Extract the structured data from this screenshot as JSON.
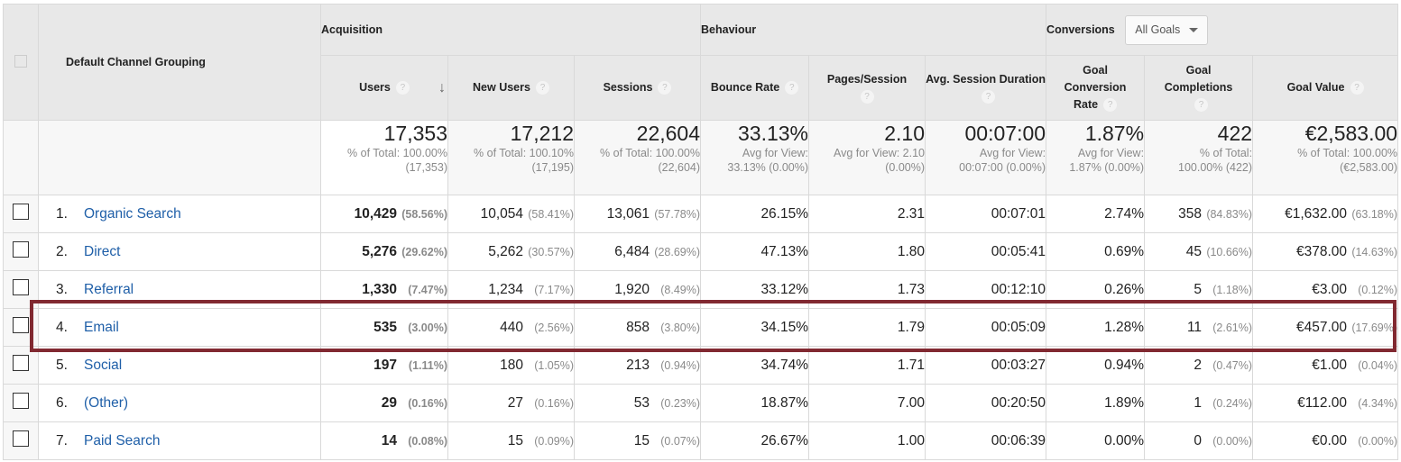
{
  "header": {
    "dimension_label": "Default Channel Grouping",
    "groups": {
      "acquisition": "Acquisition",
      "behaviour": "Behaviour",
      "conversions": "Conversions"
    },
    "goal_select": {
      "selected": "All Goals"
    },
    "columns": [
      {
        "key": "users",
        "label": "Users",
        "sorted": "descending"
      },
      {
        "key": "new_users",
        "label": "New Users"
      },
      {
        "key": "sessions",
        "label": "Sessions"
      },
      {
        "key": "bounce_rate",
        "label": "Bounce Rate"
      },
      {
        "key": "pages_session",
        "label": "Pages/Session"
      },
      {
        "key": "avg_session_duration",
        "label": "Avg. Session Duration"
      },
      {
        "key": "goal_conversion_rate",
        "label": "Goal Conversion Rate"
      },
      {
        "key": "goal_completions",
        "label": "Goal Completions"
      },
      {
        "key": "goal_value",
        "label": "Goal Value"
      }
    ],
    "help_icon": "?",
    "sort_icon": "↓"
  },
  "totals": {
    "users": {
      "value": "17,353",
      "sub1": "% of Total: 100.00%",
      "sub2": "(17,353)"
    },
    "new_users": {
      "value": "17,212",
      "sub1": "% of Total: 100.10%",
      "sub2": "(17,195)"
    },
    "sessions": {
      "value": "22,604",
      "sub1": "% of Total: 100.00%",
      "sub2": "(22,604)"
    },
    "bounce_rate": {
      "value": "33.13%",
      "sub1": "Avg for View:",
      "sub2": "33.13% (0.00%)"
    },
    "pages_session": {
      "value": "2.10",
      "sub1": "Avg for View: 2.10",
      "sub2": "(0.00%)"
    },
    "avg_session_duration": {
      "value": "00:07:00",
      "sub1": "Avg for View:",
      "sub2": "00:07:00 (0.00%)"
    },
    "goal_conversion_rate": {
      "value": "1.87%",
      "sub1": "Avg for View:",
      "sub2": "1.87% (0.00%)"
    },
    "goal_completions": {
      "value": "422",
      "sub1": "% of Total:",
      "sub2": "100.00% (422)"
    },
    "goal_value": {
      "value": "€2,583.00",
      "sub1": "% of Total: 100.00%",
      "sub2": "(€2,583.00)"
    }
  },
  "rows": [
    {
      "index": "1.",
      "channel": "Organic Search",
      "users": "10,429",
      "users_pct": "(58.56%)",
      "new_users": "10,054",
      "new_users_pct": "(58.41%)",
      "sessions": "13,061",
      "sessions_pct": "(57.78%)",
      "bounce_rate": "26.15%",
      "pages_session": "2.31",
      "avg_session_duration": "00:07:01",
      "goal_conversion_rate": "2.74%",
      "goal_completions": "358",
      "goal_completions_pct": "(84.83%)",
      "goal_value": "€1,632.00",
      "goal_value_pct": "(63.18%)"
    },
    {
      "index": "2.",
      "channel": "Direct",
      "users": "5,276",
      "users_pct": "(29.62%)",
      "new_users": "5,262",
      "new_users_pct": "(30.57%)",
      "sessions": "6,484",
      "sessions_pct": "(28.69%)",
      "bounce_rate": "47.13%",
      "pages_session": "1.80",
      "avg_session_duration": "00:05:41",
      "goal_conversion_rate": "0.69%",
      "goal_completions": "45",
      "goal_completions_pct": "(10.66%)",
      "goal_value": "€378.00",
      "goal_value_pct": "(14.63%)"
    },
    {
      "index": "3.",
      "channel": "Referral",
      "users": "1,330",
      "users_pct": "(7.47%)",
      "new_users": "1,234",
      "new_users_pct": "(7.17%)",
      "sessions": "1,920",
      "sessions_pct": "(8.49%)",
      "bounce_rate": "33.12%",
      "pages_session": "1.73",
      "avg_session_duration": "00:12:10",
      "goal_conversion_rate": "0.26%",
      "goal_completions": "5",
      "goal_completions_pct": "(1.18%)",
      "goal_value": "€3.00",
      "goal_value_pct": "(0.12%)"
    },
    {
      "index": "4.",
      "channel": "Email",
      "users": "535",
      "users_pct": "(3.00%)",
      "new_users": "440",
      "new_users_pct": "(2.56%)",
      "sessions": "858",
      "sessions_pct": "(3.80%)",
      "bounce_rate": "34.15%",
      "pages_session": "1.79",
      "avg_session_duration": "00:05:09",
      "goal_conversion_rate": "1.28%",
      "goal_completions": "11",
      "goal_completions_pct": "(2.61%)",
      "goal_value": "€457.00",
      "goal_value_pct": "(17.69%)"
    },
    {
      "index": "5.",
      "channel": "Social",
      "users": "197",
      "users_pct": "(1.11%)",
      "new_users": "180",
      "new_users_pct": "(1.05%)",
      "sessions": "213",
      "sessions_pct": "(0.94%)",
      "bounce_rate": "34.74%",
      "pages_session": "1.71",
      "avg_session_duration": "00:03:27",
      "goal_conversion_rate": "0.94%",
      "goal_completions": "2",
      "goal_completions_pct": "(0.47%)",
      "goal_value": "€1.00",
      "goal_value_pct": "(0.04%)"
    },
    {
      "index": "6.",
      "channel": "(Other)",
      "users": "29",
      "users_pct": "(0.16%)",
      "new_users": "27",
      "new_users_pct": "(0.16%)",
      "sessions": "53",
      "sessions_pct": "(0.23%)",
      "bounce_rate": "18.87%",
      "pages_session": "7.00",
      "avg_session_duration": "00:20:50",
      "goal_conversion_rate": "1.89%",
      "goal_completions": "1",
      "goal_completions_pct": "(0.24%)",
      "goal_value": "€112.00",
      "goal_value_pct": "(4.34%)"
    },
    {
      "index": "7.",
      "channel": "Paid Search",
      "users": "14",
      "users_pct": "(0.08%)",
      "new_users": "15",
      "new_users_pct": "(0.09%)",
      "sessions": "15",
      "sessions_pct": "(0.07%)",
      "bounce_rate": "26.67%",
      "pages_session": "1.00",
      "avg_session_duration": "00:06:39",
      "goal_conversion_rate": "0.00%",
      "goal_completions": "0",
      "goal_completions_pct": "(0.00%)",
      "goal_value": "€0.00",
      "goal_value_pct": "(0.00%)"
    }
  ],
  "highlight": {
    "row_index": 3,
    "color": "#812931"
  }
}
